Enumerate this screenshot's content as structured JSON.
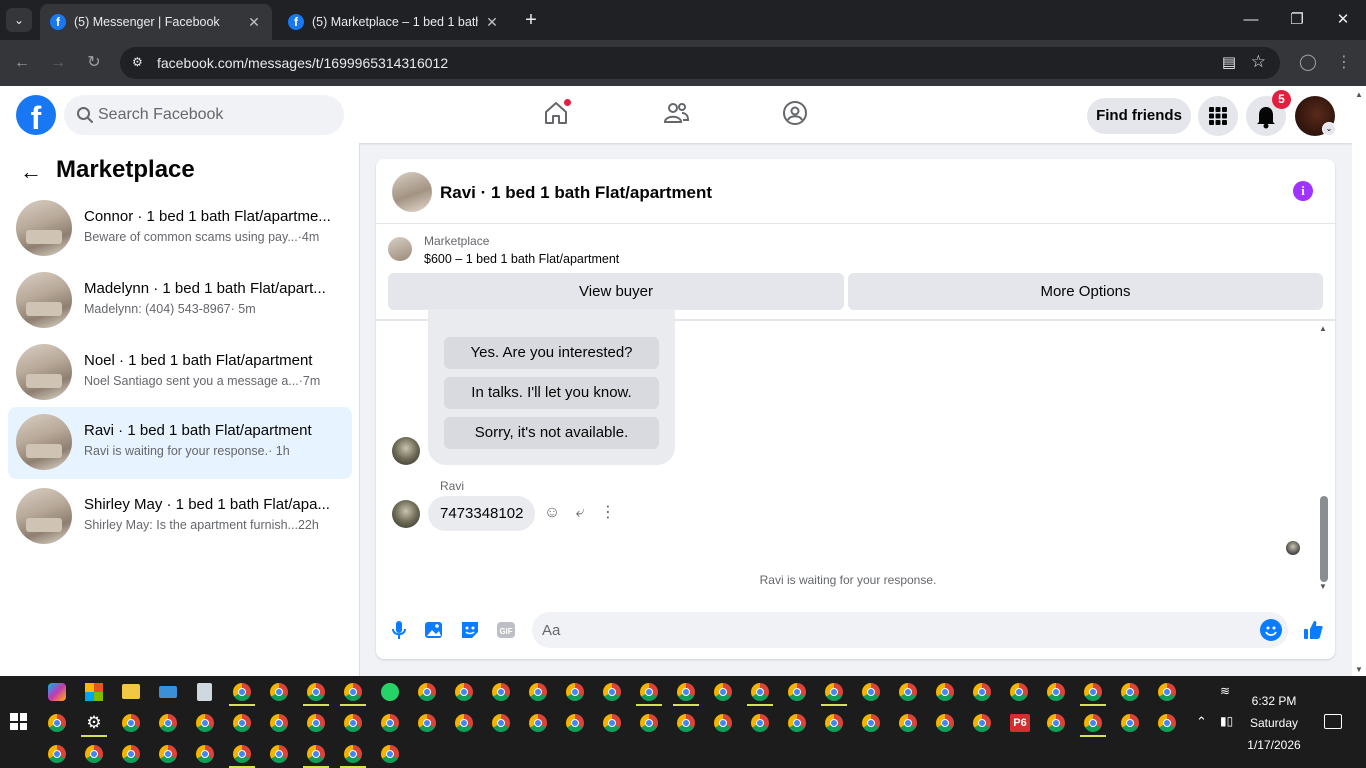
{
  "browser": {
    "tabs": [
      {
        "title": "(5) Messenger | Facebook",
        "active": true
      },
      {
        "title": "(5) Marketplace – 1 bed 1 bath F",
        "active": false
      }
    ],
    "url": "facebook.com/messages/t/1699965314316012"
  },
  "header": {
    "logo": "f",
    "search_placeholder": "Search Facebook",
    "find_friends": "Find friends",
    "notifications_count": "5",
    "accent": "#1877f2"
  },
  "sidebar": {
    "title": "Marketplace",
    "conversations": [
      {
        "name": "Connor · 1 bed 1 bath Flat/apartme...",
        "preview": "Beware of common scams using pay...",
        "time": " ·4m",
        "selected": false
      },
      {
        "name": "Madelynn · 1 bed 1 bath Flat/apart...",
        "preview": "Madelynn: (404) 543-8967",
        "time": " · 5m",
        "selected": false
      },
      {
        "name": "Noel · 1 bed 1 bath Flat/apartment",
        "preview": "Noel Santiago sent you a message a...",
        "time": " ·7m",
        "selected": false
      },
      {
        "name": "Ravi · 1 bed 1 bath Flat/apartment",
        "preview": "Ravi is waiting for your response.",
        "time": " · 1h",
        "selected": true
      },
      {
        "name": "Shirley May · 1 bed 1 bath Flat/apa...",
        "preview": "Shirley May: Is the apartment furnish...",
        "time": " 22h",
        "selected": false
      }
    ]
  },
  "chat": {
    "title": "Ravi · 1 bed 1 bath Flat/apartment",
    "marketplace_label": "Marketplace",
    "listing": "$600 – 1 bed 1 bath Flat/apartment",
    "view_buyer": "View buyer",
    "more_options": "More Options",
    "quick_replies": [
      "Yes. Are you interested?",
      "In talks. I'll let you know.",
      "Sorry, it's not available."
    ],
    "sender_name": "Ravi",
    "message": "7473348102",
    "status": "Ravi is waiting for your response.",
    "composer_placeholder": "Aa"
  },
  "taskbar": {
    "time": "6:32 PM",
    "day": "Saturday",
    "date": "1/17/2026",
    "p6_label": "P6"
  }
}
